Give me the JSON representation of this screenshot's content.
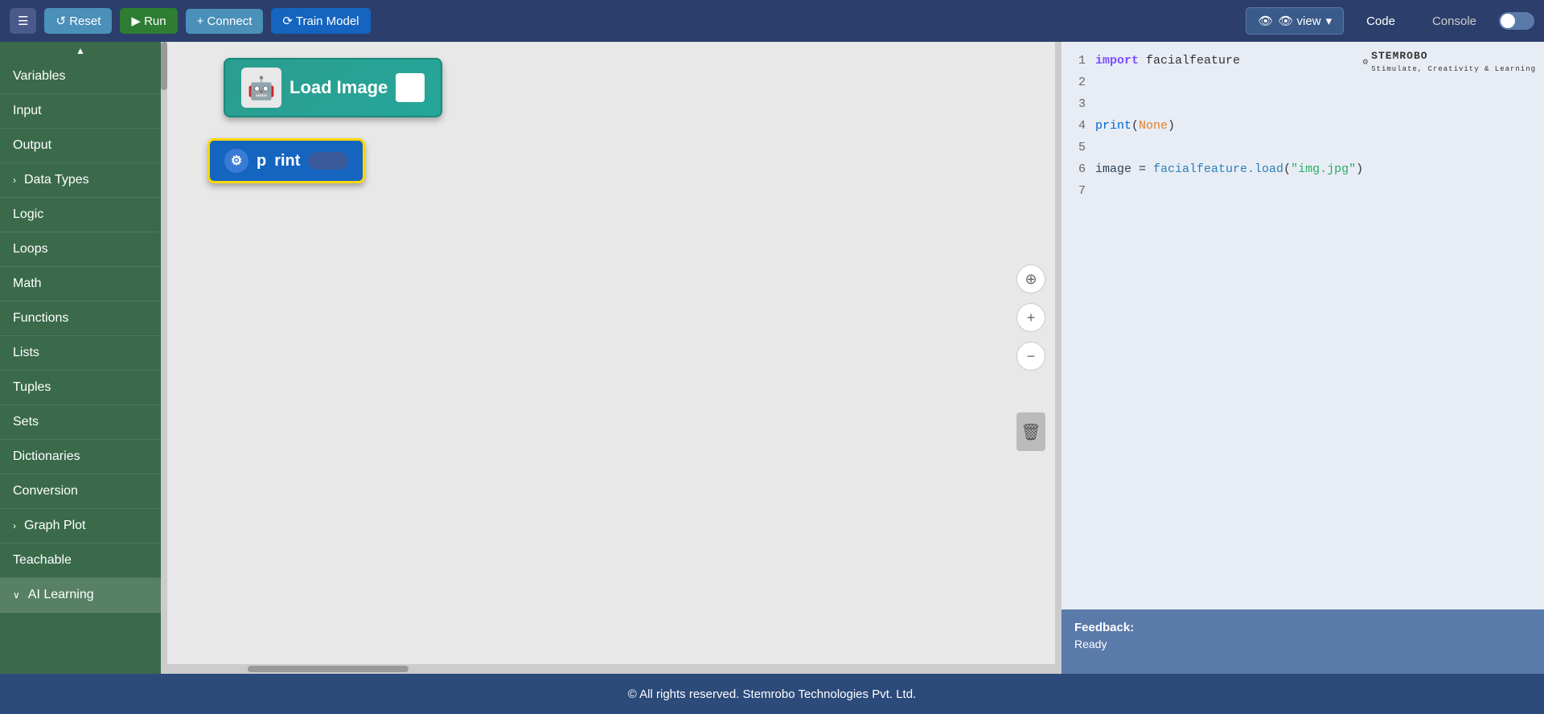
{
  "toolbar": {
    "menu_label": "☰",
    "reset_label": "↺  Reset",
    "run_label": "▶  Run",
    "connect_label": "+  Connect",
    "train_label": "⟳  Train Model",
    "view_label": "👁  view",
    "code_label": "Code",
    "console_label": "Console"
  },
  "sidebar": {
    "items": [
      {
        "id": "variables",
        "label": "Variables",
        "arrow": ""
      },
      {
        "id": "input",
        "label": "Input",
        "arrow": ""
      },
      {
        "id": "output",
        "label": "Output",
        "arrow": ""
      },
      {
        "id": "data-types",
        "label": "Data Types",
        "arrow": "›"
      },
      {
        "id": "logic",
        "label": "Logic",
        "arrow": ""
      },
      {
        "id": "loops",
        "label": "Loops",
        "arrow": ""
      },
      {
        "id": "math",
        "label": "Math",
        "arrow": ""
      },
      {
        "id": "functions",
        "label": "Functions",
        "arrow": ""
      },
      {
        "id": "lists",
        "label": "Lists",
        "arrow": ""
      },
      {
        "id": "tuples",
        "label": "Tuples",
        "arrow": ""
      },
      {
        "id": "sets",
        "label": "Sets",
        "arrow": ""
      },
      {
        "id": "dictionaries",
        "label": "Dictionaries",
        "arrow": ""
      },
      {
        "id": "conversion",
        "label": "Conversion",
        "arrow": ""
      },
      {
        "id": "graph-plot",
        "label": "Graph Plot",
        "arrow": "›"
      },
      {
        "id": "teachable",
        "label": "Teachable",
        "arrow": ""
      },
      {
        "id": "ai-learning",
        "label": "AI Learning",
        "arrow": "∨",
        "expanded": true
      }
    ]
  },
  "blocks": {
    "load_image_label": "Load Image",
    "print_label": "rint"
  },
  "code": {
    "lines": [
      {
        "num": "1",
        "content": "import facialfeature",
        "type": "import"
      },
      {
        "num": "2",
        "content": "",
        "type": "blank"
      },
      {
        "num": "3",
        "content": "",
        "type": "blank"
      },
      {
        "num": "4",
        "content": "print(None)",
        "type": "print"
      },
      {
        "num": "5",
        "content": "",
        "type": "blank"
      },
      {
        "num": "6",
        "content": "image = facialfeature.load(\"img.jpg\")",
        "type": "assign"
      },
      {
        "num": "7",
        "content": "",
        "type": "blank"
      }
    ]
  },
  "feedback": {
    "label": "Feedback:",
    "status": "Ready"
  },
  "footer": {
    "text": "© All rights reserved. Stemrobo Technologies Pvt. Ltd."
  },
  "logo": {
    "text": "✦ STEMROBO"
  }
}
